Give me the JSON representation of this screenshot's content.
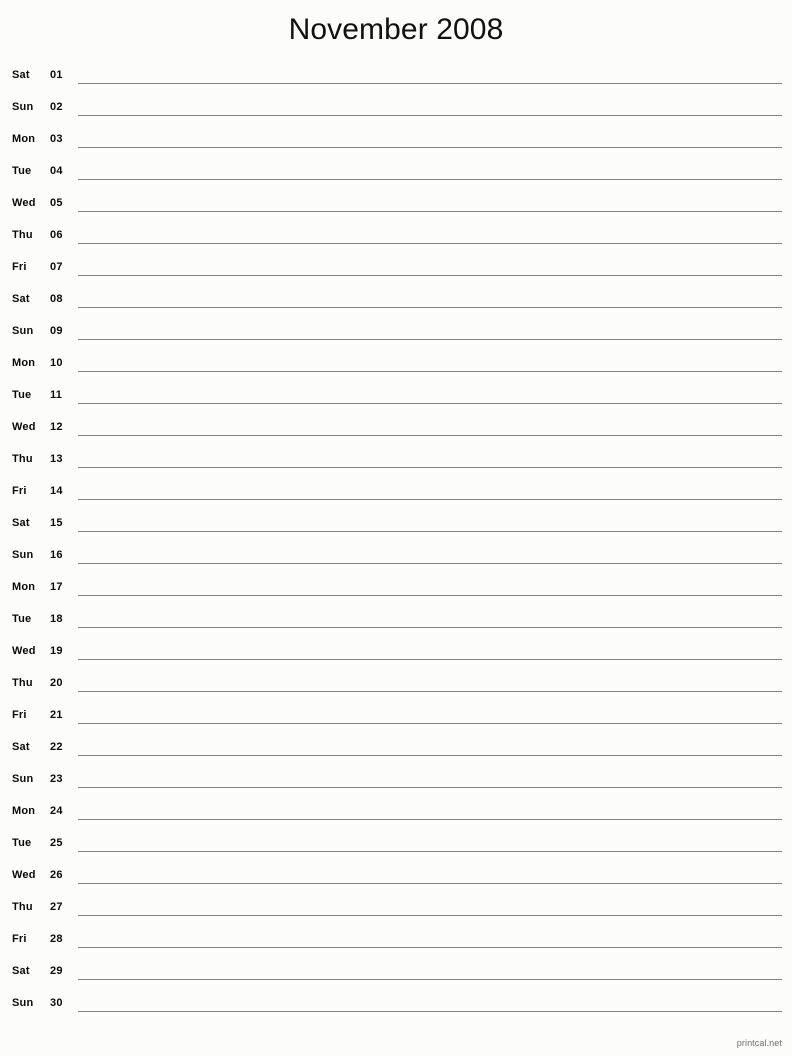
{
  "document": {
    "type": "printable-monthly-calendar",
    "title": "November 2008",
    "month": "November",
    "year": "2008"
  },
  "footer": {
    "attribution": "printcal.net"
  },
  "columns": {
    "weekday_header": "",
    "date_header": "",
    "notes_header": ""
  },
  "days": [
    {
      "dow": "Sat",
      "date": "01",
      "notes": ""
    },
    {
      "dow": "Sun",
      "date": "02",
      "notes": ""
    },
    {
      "dow": "Mon",
      "date": "03",
      "notes": ""
    },
    {
      "dow": "Tue",
      "date": "04",
      "notes": ""
    },
    {
      "dow": "Wed",
      "date": "05",
      "notes": ""
    },
    {
      "dow": "Thu",
      "date": "06",
      "notes": ""
    },
    {
      "dow": "Fri",
      "date": "07",
      "notes": ""
    },
    {
      "dow": "Sat",
      "date": "08",
      "notes": ""
    },
    {
      "dow": "Sun",
      "date": "09",
      "notes": ""
    },
    {
      "dow": "Mon",
      "date": "10",
      "notes": ""
    },
    {
      "dow": "Tue",
      "date": "11",
      "notes": ""
    },
    {
      "dow": "Wed",
      "date": "12",
      "notes": ""
    },
    {
      "dow": "Thu",
      "date": "13",
      "notes": ""
    },
    {
      "dow": "Fri",
      "date": "14",
      "notes": ""
    },
    {
      "dow": "Sat",
      "date": "15",
      "notes": ""
    },
    {
      "dow": "Sun",
      "date": "16",
      "notes": ""
    },
    {
      "dow": "Mon",
      "date": "17",
      "notes": ""
    },
    {
      "dow": "Tue",
      "date": "18",
      "notes": ""
    },
    {
      "dow": "Wed",
      "date": "19",
      "notes": ""
    },
    {
      "dow": "Thu",
      "date": "20",
      "notes": ""
    },
    {
      "dow": "Fri",
      "date": "21",
      "notes": ""
    },
    {
      "dow": "Sat",
      "date": "22",
      "notes": ""
    },
    {
      "dow": "Sun",
      "date": "23",
      "notes": ""
    },
    {
      "dow": "Mon",
      "date": "24",
      "notes": ""
    },
    {
      "dow": "Tue",
      "date": "25",
      "notes": ""
    },
    {
      "dow": "Wed",
      "date": "26",
      "notes": ""
    },
    {
      "dow": "Thu",
      "date": "27",
      "notes": ""
    },
    {
      "dow": "Fri",
      "date": "28",
      "notes": ""
    },
    {
      "dow": "Sat",
      "date": "29",
      "notes": ""
    },
    {
      "dow": "Sun",
      "date": "30",
      "notes": ""
    }
  ],
  "colors": {
    "page_background": "#fcfdfa",
    "text": "#0b0b0b",
    "title_text": "#111111",
    "rule_line": "#7f877f",
    "footer_text": "#6d6d6d"
  }
}
